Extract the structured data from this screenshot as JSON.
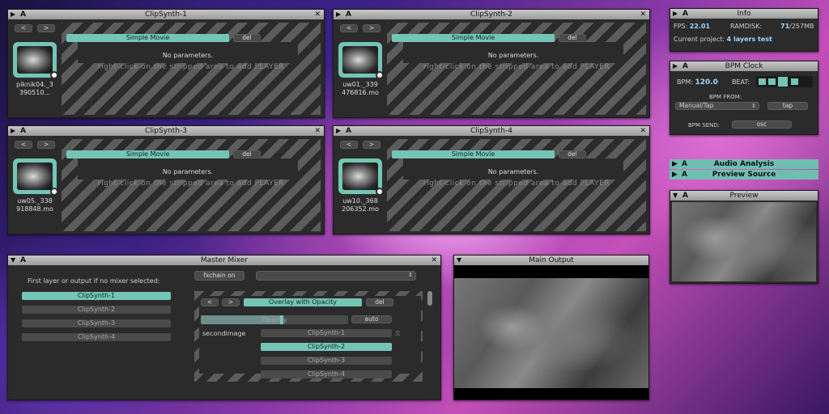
{
  "clipsynths": [
    {
      "title": "ClipSynth-1",
      "prev": "<",
      "next": ">",
      "effect": "Simple Movie",
      "del": "del",
      "no_params": "No parameters.",
      "hint": "right-click on the stripped area to add PLAYER",
      "file_line1": "piknik04._3",
      "file_line2": "390510..."
    },
    {
      "title": "ClipSynth-2",
      "prev": "<",
      "next": ">",
      "effect": "Simple Movie",
      "del": "del",
      "no_params": "No parameters.",
      "hint": "right-click on the stripped area to add PLAYER",
      "file_line1": "uw01._339",
      "file_line2": "476816.mo"
    },
    {
      "title": "ClipSynth-3",
      "prev": "<",
      "next": ">",
      "effect": "Simple Movie",
      "del": "del",
      "no_params": "No parameters.",
      "hint": "right-click on the stripped area to add PLAYER",
      "file_line1": "uw05._338",
      "file_line2": "918848.mo"
    },
    {
      "title": "ClipSynth-4",
      "prev": "<",
      "next": ">",
      "effect": "Simple Movie",
      "del": "del",
      "no_params": "No parameters.",
      "hint": "right-click on the stripped area to add PLAYER",
      "file_line1": "uw10._368",
      "file_line2": "206352.mo"
    }
  ],
  "window_controls": {
    "a": "A",
    "close": "✕",
    "collapse": "▶",
    "expand": "▼"
  },
  "info": {
    "title": "Info",
    "fps_label": "FPS:",
    "fps_value": "22.01",
    "ramdisk_label": "RAMDISK:",
    "ramdisk_value": "71",
    "ramdisk_total": "/257MB",
    "project_label": "Current project:",
    "project_value": "4 layers test"
  },
  "bpm": {
    "title": "BPM Clock",
    "bpm_label": "BPM:",
    "bpm_value": "120.0",
    "beat_label": "BEAT:",
    "from_label": "BPM FROM:",
    "from_value": "Manual/Tap",
    "tap": "tap",
    "send_label": "BPM SEND:",
    "send_value": "osc"
  },
  "audio": {
    "title": "Audio Analysis"
  },
  "preview_source": {
    "title": "Preview Source"
  },
  "preview": {
    "title": "Preview"
  },
  "mixer": {
    "title": "Master Mixer",
    "first_layer_label": "First layer or output if no mixer selected:",
    "layers": [
      "ClipSynth-1",
      "ClipSynth-2",
      "ClipSynth-3",
      "ClipSynth-4"
    ],
    "selected_layer": "ClipSynth-1",
    "fxchain": "fxchain on",
    "prev": "<",
    "next": ">",
    "effect": "Overlay with Opacity",
    "del": "del",
    "opacity_label": "Opacity",
    "opacity_value": 0.55,
    "auto": "auto",
    "second_label": "secondimage",
    "second_options": [
      "ClipSynth-1",
      "ClipSynth-2",
      "ClipSynth-3",
      "ClipSynth-4"
    ],
    "second_selected": "ClipSynth-2"
  },
  "main_output": {
    "title": "Main Output"
  },
  "colors": {
    "accent": "#74c5b6",
    "panel": "#2b2b2b",
    "titlebar": "#b5b5b5"
  }
}
